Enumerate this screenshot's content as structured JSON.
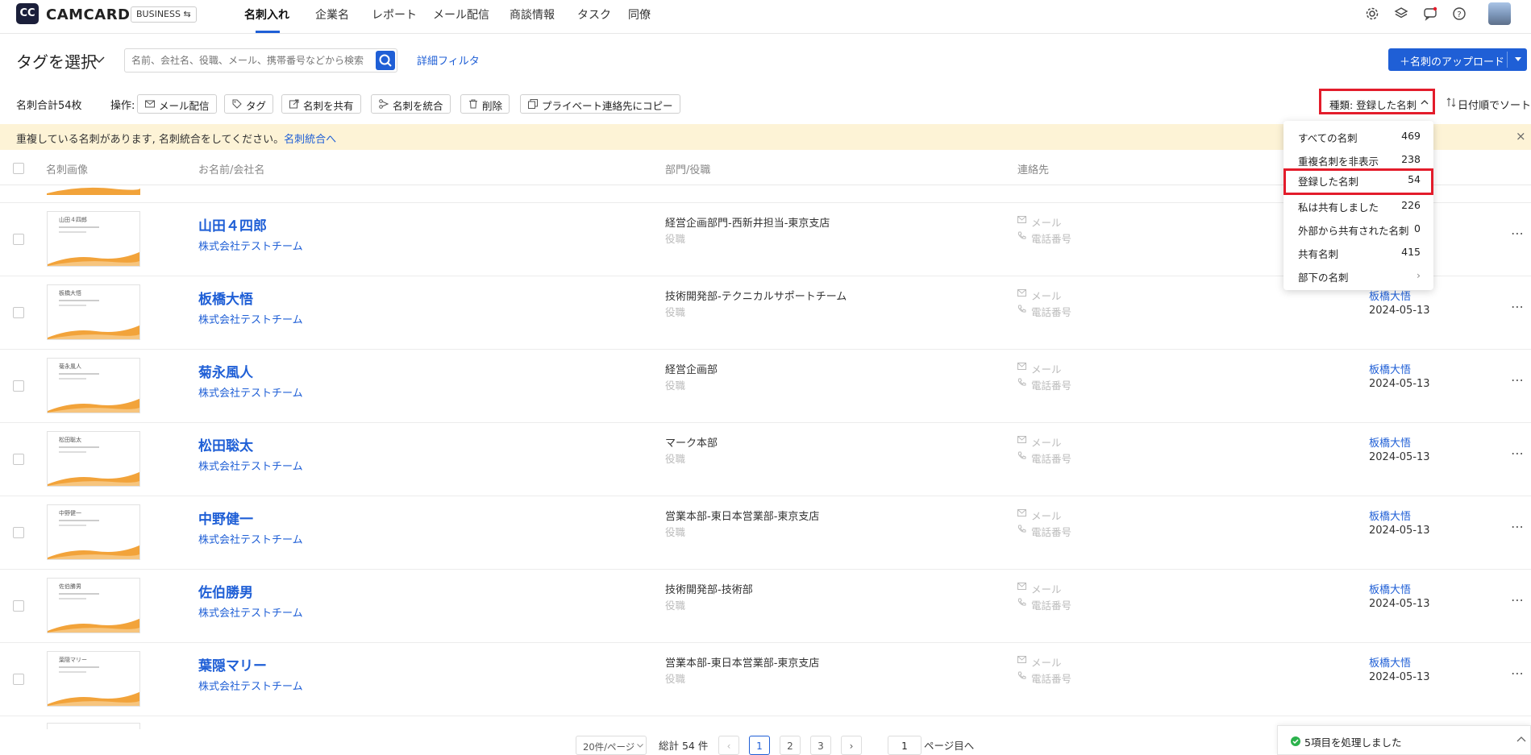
{
  "header": {
    "logo_text": "CC",
    "brand": "CAMCARD",
    "business_badge": "BUSINESS ⇆",
    "nav": [
      "名刺入れ",
      "企業名",
      "レポート",
      "メール配信",
      "商談情報",
      "タスク",
      "同僚"
    ],
    "icons": [
      "gear-icon",
      "layers-icon",
      "chat-icon",
      "help-icon",
      "avatar"
    ]
  },
  "toolbar": {
    "tag_select": "タグを選択",
    "search_placeholder": "名前、会社名、役職、メール、携帯番号などから検索",
    "advanced_filter": "詳細フィルタ",
    "upload_label": "＋名刺のアップロード"
  },
  "ops": {
    "count_text": "名刺合計54枚",
    "ops_label": "操作:",
    "buttons": [
      "メール配信",
      "タグ",
      "名刺を共有",
      "名刺を統合",
      "削除",
      "プライベート連絡先にコピー"
    ],
    "type_filter": "種類: 登録した名刺",
    "sort": "日付順でソート"
  },
  "notice": {
    "text": "重複している名刺があります, 名刺統合をしてください。",
    "link": "名刺統合へ",
    "close": "×"
  },
  "table_headers": {
    "image": "名刺画像",
    "name": "お名前/会社名",
    "dept": "部門/役職",
    "contact": "連絡先"
  },
  "rows": [
    {
      "name": "山田４四郎",
      "company": "株式会社テストチーム",
      "dept": "経営企画部門-西新井担当-東京支店",
      "title": "役職",
      "mail": "メール",
      "phone": "電話番号",
      "owner": "",
      "date": ""
    },
    {
      "name": "板橋大悟",
      "company": "株式会社テストチーム",
      "dept": "技術開発部-テクニカルサポートチーム",
      "title": "役職",
      "mail": "メール",
      "phone": "電話番号",
      "owner": "板橋大悟",
      "date": "2024-05-13"
    },
    {
      "name": "菊永風人",
      "company": "株式会社テストチーム",
      "dept": "経営企画部",
      "title": "役職",
      "mail": "メール",
      "phone": "電話番号",
      "owner": "板橋大悟",
      "date": "2024-05-13"
    },
    {
      "name": "松田聡太",
      "company": "株式会社テストチーム",
      "dept": "マーク本部",
      "title": "役職",
      "mail": "メール",
      "phone": "電話番号",
      "owner": "板橋大悟",
      "date": "2024-05-13"
    },
    {
      "name": "中野健一",
      "company": "株式会社テストチーム",
      "dept": "営業本部-東日本営業部-東京支店",
      "title": "役職",
      "mail": "メール",
      "phone": "電話番号",
      "owner": "板橋大悟",
      "date": "2024-05-13"
    },
    {
      "name": "佐伯勝男",
      "company": "株式会社テストチーム",
      "dept": "技術開発部-技術部",
      "title": "役職",
      "mail": "メール",
      "phone": "電話番号",
      "owner": "板橋大悟",
      "date": "2024-05-13"
    },
    {
      "name": "葉隠マリー",
      "company": "株式会社テストチーム",
      "dept": "営業本部-東日本営業部-東京支店",
      "title": "役職",
      "mail": "メール",
      "phone": "電話番号",
      "owner": "板橋大悟",
      "date": "2024-05-13"
    }
  ],
  "dropdown": [
    {
      "label": "すべての名刺",
      "count": "469"
    },
    {
      "label": "重複名刺を非表示",
      "count": "238"
    },
    {
      "label": "登録した名刺",
      "count": "54"
    },
    {
      "label": "私は共有しました",
      "count": "226"
    },
    {
      "label": "外部から共有された名刺",
      "count": "0"
    },
    {
      "label": "共有名刺",
      "count": "415"
    },
    {
      "label": "部下の名刺",
      "count": "›"
    }
  ],
  "pagination": {
    "page_size": "20件/ページ",
    "total": "総計 54 件",
    "pages": [
      "1",
      "2",
      "3"
    ],
    "current": "1",
    "goto_value": "1",
    "goto_suffix": "ページ目へ"
  },
  "toast": {
    "text": "5項目を処理しました"
  },
  "colors": {
    "accent": "#1f5fd6",
    "highlight": "#e31c2b",
    "notice_bg": "#fdf3d6",
    "card_wave": "#f2a33a"
  }
}
